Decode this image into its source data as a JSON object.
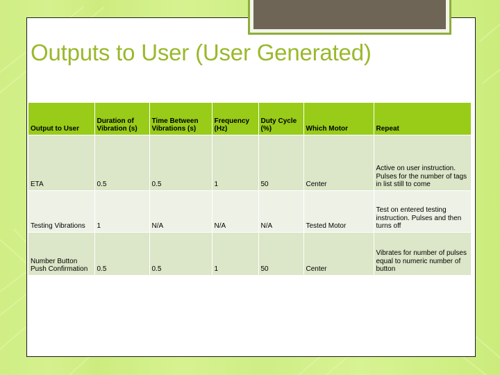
{
  "slide": {
    "title": "Outputs to User (User Generated)",
    "accent_color": "#9ab82c",
    "background_color": "#d2f08a",
    "header_fill": "#98cc18",
    "decor_block_color": "#6e6556"
  },
  "table": {
    "headers": [
      "Output to User",
      "Duration of Vibration (s)",
      "Time Between Vibrations (s)",
      "Frequency (Hz)",
      "Duty Cycle (%)",
      "Which Motor",
      "Repeat"
    ],
    "rows": [
      {
        "output_to_user": "ETA",
        "duration_of_vibration_s": "0.5",
        "time_between_vibrations_s": "0.5",
        "frequency_hz": "1",
        "duty_cycle_pct": "50",
        "which_motor": "Center",
        "repeat": "Active on user instruction. Pulses for the number of tags in list still to come"
      },
      {
        "output_to_user": "Testing Vibrations",
        "duration_of_vibration_s": "1",
        "time_between_vibrations_s": "N/A",
        "frequency_hz": "N/A",
        "duty_cycle_pct": "N/A",
        "which_motor": "Tested Motor",
        "repeat": "Test on entered testing instruction. Pulses and then turns off"
      },
      {
        "output_to_user": "Number Button Push Confirmation",
        "duration_of_vibration_s": "0.5",
        "time_between_vibrations_s": "0.5",
        "frequency_hz": "1",
        "duty_cycle_pct": "50",
        "which_motor": "Center",
        "repeat": "Vibrates for number of pulses equal to numeric number of button"
      }
    ]
  }
}
